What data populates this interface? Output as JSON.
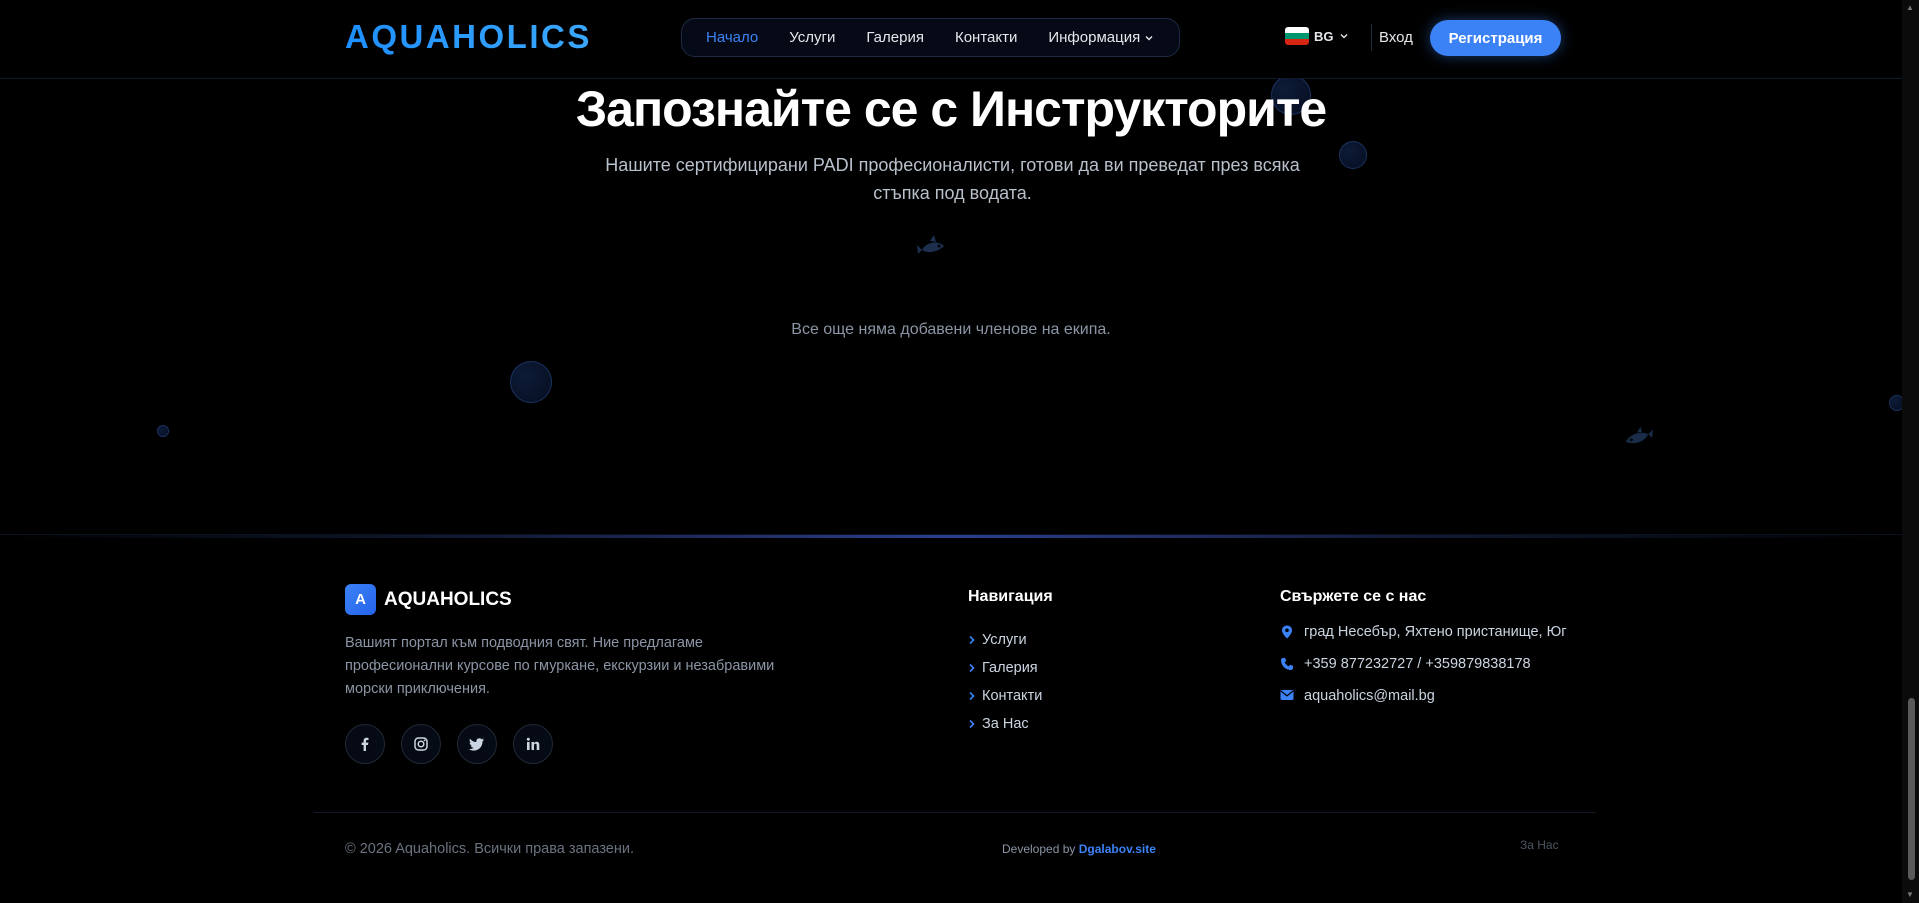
{
  "header": {
    "brand": "AQUAHOLICS",
    "nav": [
      {
        "label": "Начало",
        "active": true
      },
      {
        "label": "Услуги",
        "active": false
      },
      {
        "label": "Галерия",
        "active": false
      },
      {
        "label": "Контакти",
        "active": false
      },
      {
        "label": "Информация",
        "active": false,
        "dropdown": true
      }
    ],
    "language": {
      "code": "BG",
      "flag": "bulgaria-flag-icon"
    },
    "login_label": "Вход",
    "register_label": "Регистрация"
  },
  "hero": {
    "title": "Запознайте се с Инструкторите",
    "subtitle": "Нашите сертифицирани PADI професионалисти, готови да ви преведат през всяка стъпка под водата.",
    "empty_message": "Все още няма добавени членове на екипа."
  },
  "footer": {
    "logo_letter": "A",
    "brand": "AQUAHOLICS",
    "description": "Вашият портал към подводния свят. Ние предлагаме професионални курсове по гмуркане, екскурзии и незабравими морски приключения.",
    "socials": [
      "facebook-icon",
      "instagram-icon",
      "twitter-icon",
      "linkedin-icon"
    ],
    "nav_title": "Навигация",
    "nav_items": [
      "Услуги",
      "Галерия",
      "Контакти",
      "За Нас"
    ],
    "contact_title": "Свържете се с нас",
    "contact": {
      "address": "град Несебър, Яхтено пристанище, Юг",
      "phone": "+359 877232727 / +359879838178",
      "email": "aquaholics@mail.bg"
    },
    "copyright": "© 2026 Aquaholics. Всички права запазени.",
    "developed_prefix": "Developed by",
    "developed_link": "Dgalabov.site",
    "about_link": "За Нас"
  },
  "colors": {
    "accent": "#3b82f6",
    "brand": "#2a8ff0",
    "background": "#000000"
  }
}
